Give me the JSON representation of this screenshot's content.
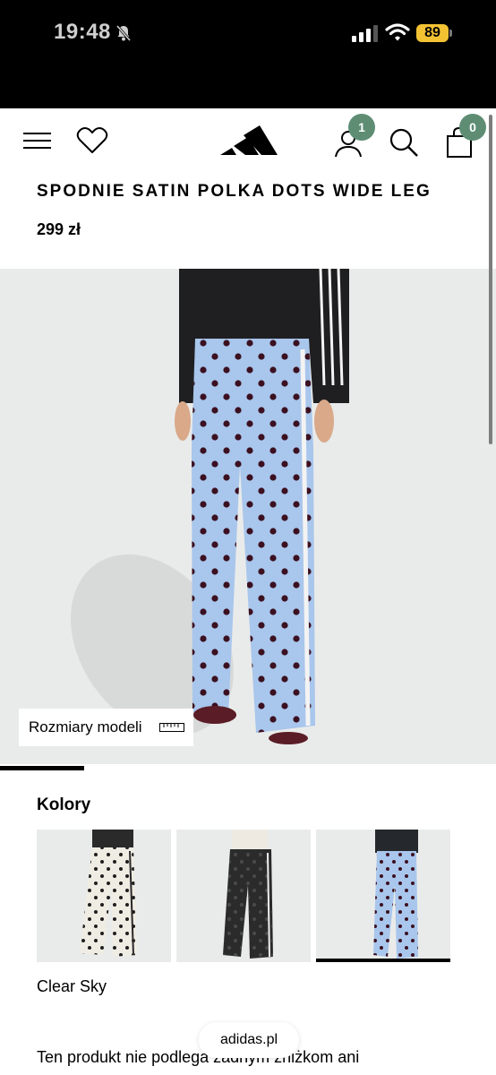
{
  "status_bar": {
    "time": "19:48",
    "battery": "89",
    "icons": [
      "bell-slash-icon",
      "signal-icon",
      "wifi-icon",
      "battery-icon"
    ]
  },
  "header": {
    "account_badge": "1",
    "bag_badge": "0",
    "icons": [
      "menu-icon",
      "heart-icon",
      "adidas-logo",
      "account-icon",
      "search-icon",
      "shopping-bag-icon"
    ],
    "badge_color": "#5e8d74"
  },
  "product": {
    "title": "SPODNIE SATIN POLKA DOTS WIDE LEG",
    "price": "299 zł",
    "model_sizes_label": "Rozmiary modeli",
    "gallery_progress": 0.17
  },
  "colors": {
    "heading": "Kolory",
    "selected_name": "Clear Sky",
    "swatches": [
      {
        "pants_color": "#efece3",
        "dot_color": "#1e1e1e",
        "top_color": "#2a2a2a"
      },
      {
        "pants_color": "#2b2b2b",
        "dot_color": "#4a4a4a",
        "top_color": "#eeeae2"
      },
      {
        "pants_color": "#a9c6ec",
        "dot_color": "#3b1020",
        "top_color": "#25282d"
      }
    ]
  },
  "disclaimer": "Ten produkt nie podlega żadnym zniżkom ani",
  "browser": {
    "url": "adidas.pl"
  }
}
